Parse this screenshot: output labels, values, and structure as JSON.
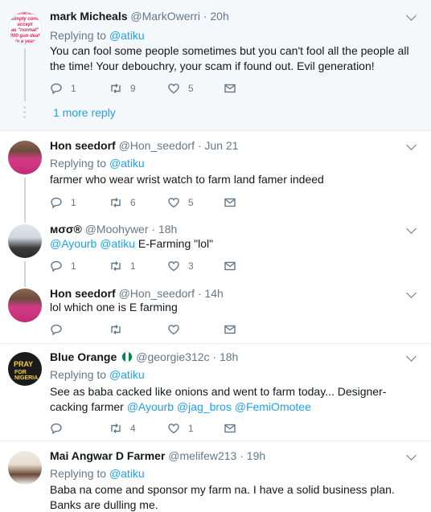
{
  "icons": {
    "reply": "reply-icon",
    "retweet": "retweet-icon",
    "like": "heart-icon",
    "dm": "envelope-icon",
    "menu": "chevron-down-icon"
  },
  "tweets": [
    {
      "avatar_text": [
        "America",
        "simply cons",
        "accept",
        "as \"normal\"",
        "000 gun deat",
        "in a year"
      ],
      "name": "mark Micheals",
      "handle": "@MarkOwerri",
      "time": "20h",
      "replying_label": "Replying to",
      "replying_to": "@atiku",
      "text": "You can fool some people sometimes but you can't fool all the people all the time! Your debouchry, your scam if found out. Evil generation!",
      "replies": "1",
      "retweets": "9",
      "likes": "5",
      "more_replies": "1 more reply"
    },
    {
      "name": "Hon seedorf",
      "handle": "@Hon_seedorf",
      "time": "Jun 21",
      "replying_label": "Replying to",
      "replying_to": "@atiku",
      "text": "farmer who wear wrist watch to farm land famer indeed",
      "replies": "1",
      "retweets": "6",
      "likes": "5"
    },
    {
      "name": "мσσ®",
      "handle": "@Moohywer",
      "time": "18h",
      "mentions": [
        "@Ayourb",
        "@atiku"
      ],
      "text": "E-Farming \"lol\"",
      "replies": "1",
      "retweets": "1",
      "likes": "3"
    },
    {
      "name": "Hon seedorf",
      "handle": "@Hon_seedorf",
      "time": "14h",
      "text": "lol which one is E farming",
      "replies": "",
      "retweets": "",
      "likes": ""
    },
    {
      "avatar_text": [
        "PRAY",
        "FOR NIGERIA"
      ],
      "name": "Blue Orange",
      "handle": "@georgie312c",
      "time": "18h",
      "replying_label": "Replying to",
      "replying_to": "@atiku",
      "text": "See as baba cacked like onions and went to farm today...  Designer-cacking farmer",
      "mentions": [
        "@Ayourb",
        "@jag_bros",
        "@FemiOmotee"
      ],
      "replies": "",
      "retweets": "4",
      "likes": "1"
    },
    {
      "name": "Mai Angwar D Farmer",
      "handle": "@melifew213",
      "time": "19h",
      "replying_label": "Replying to",
      "replying_to": "@atiku",
      "text": "Baba na come and sponsor my farm na. I have a solid business plan. Banks are dulling me."
    }
  ]
}
